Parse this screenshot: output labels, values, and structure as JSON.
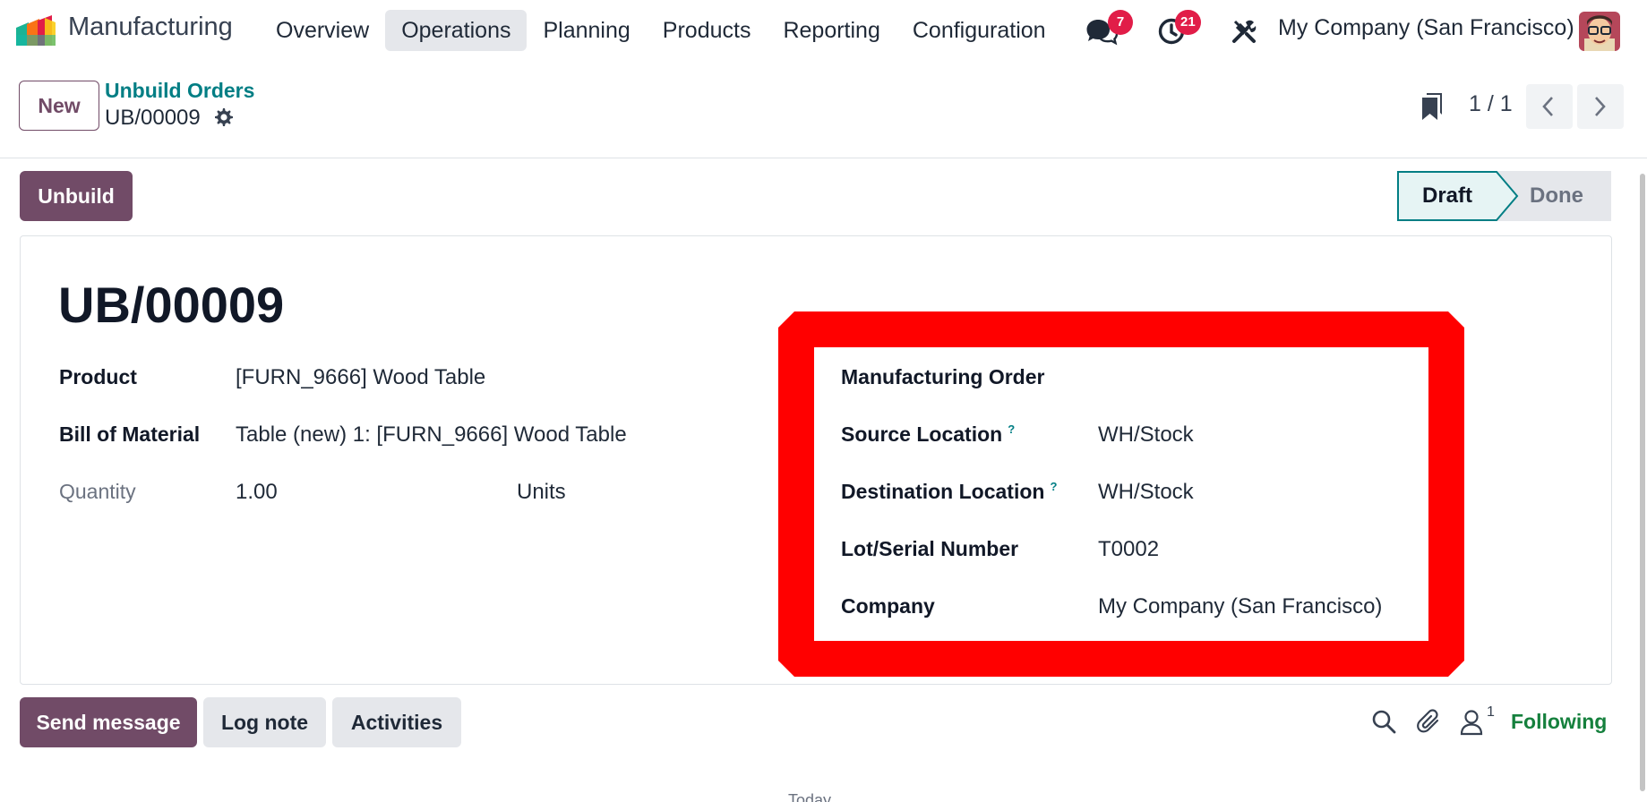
{
  "navbar": {
    "app_name": "Manufacturing",
    "menu": [
      "Overview",
      "Operations",
      "Planning",
      "Products",
      "Reporting",
      "Configuration"
    ],
    "active_menu": "Operations",
    "messages_count": "7",
    "activities_count": "21",
    "company": "My Company (San Francisco)",
    "icons": [
      "manufacturing-app-icon",
      "chat-icon",
      "clock-icon",
      "tools-icon",
      "user-avatar"
    ]
  },
  "control": {
    "new_label": "New",
    "breadcrumb": "Unbuild Orders",
    "record": "UB/00009",
    "pager": "1 / 1"
  },
  "status": {
    "action_label": "Unbuild",
    "stages": [
      "Draft",
      "Done"
    ],
    "current": "Draft"
  },
  "form": {
    "title": "UB/00009",
    "left": {
      "product_label": "Product",
      "product_value": "[FURN_9666] Wood Table",
      "bom_label": "Bill of Material",
      "bom_value": "Table (new) 1: [FURN_9666] Wood Table",
      "quantity_label": "Quantity",
      "quantity_value": "1.00",
      "uom_value": "Units"
    },
    "right": {
      "mo_label": "Manufacturing Order",
      "src_label": "Source Location",
      "src_value": "WH/Stock",
      "dest_label": "Destination Location",
      "dest_value": "WH/Stock",
      "lot_label": "Lot/Serial Number",
      "lot_value": "T0002",
      "company_label": "Company",
      "company_value": "My Company (San Francisco)",
      "help_marker": "?"
    },
    "highlight_color": "#ff0000"
  },
  "chatter": {
    "send_label": "Send message",
    "log_label": "Log note",
    "activities_label": "Activities",
    "followers": "1",
    "following_label": "Following",
    "date_separator": "Today"
  },
  "colors": {
    "primary": "#714b67",
    "link": "#017e84",
    "following": "#15803d",
    "badge": "#e11d48"
  }
}
